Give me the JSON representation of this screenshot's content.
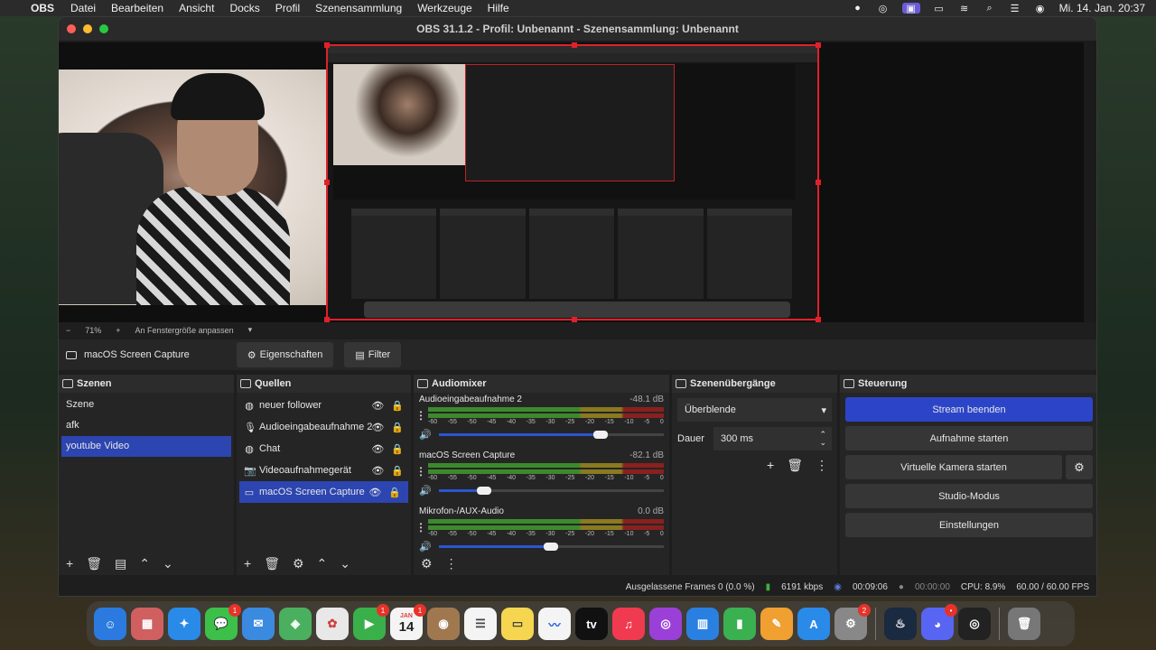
{
  "menubar": {
    "app_name": "OBS",
    "items": [
      "Datei",
      "Bearbeiten",
      "Ansicht",
      "Docks",
      "Profil",
      "Szenensammlung",
      "Werkzeuge",
      "Hilfe"
    ],
    "clock": "Mi. 14. Jan.  20:37"
  },
  "window": {
    "title": "OBS 31.1.2 - Profil: Unbenannt - Szenensammlung: Unbenannt"
  },
  "zoom": {
    "minus": "−",
    "level": "71%",
    "plus": "+",
    "fit_label": "An Fenstergröße anpassen"
  },
  "source_toolbar": {
    "selected_source": "macOS Screen Capture",
    "properties_label": "Eigenschaften",
    "filter_label": "Filter"
  },
  "scenes": {
    "title": "Szenen",
    "items": [
      {
        "label": "Szene"
      },
      {
        "label": "afk"
      },
      {
        "label": "youtube Video"
      }
    ],
    "selected_index": 2
  },
  "sources": {
    "title": "Quellen",
    "items": [
      {
        "label": "neuer follower",
        "icon": "globe-icon"
      },
      {
        "label": "Audioeingabeaufnahme 2",
        "icon": "microphone-icon"
      },
      {
        "label": "Chat",
        "icon": "globe-icon"
      },
      {
        "label": "Videoaufnahmegerät",
        "icon": "camera-icon"
      },
      {
        "label": "macOS Screen Capture",
        "icon": "monitor-icon"
      }
    ],
    "selected_index": 4
  },
  "mixer": {
    "title": "Audiomixer",
    "ticks": [
      "-60",
      "-55",
      "-50",
      "-45",
      "-40",
      "-35",
      "-30",
      "-25",
      "-20",
      "-15",
      "-10",
      "-5",
      "0"
    ],
    "channels": [
      {
        "name": "Audioeingabeaufnahme 2",
        "db": "-48.1 dB",
        "volume": 0.72
      },
      {
        "name": "macOS Screen Capture",
        "db": "-82.1 dB",
        "volume": 0.2
      },
      {
        "name": "Mikrofon-/AUX-Audio",
        "db": "0.0 dB",
        "volume": 0.5
      }
    ]
  },
  "transitions": {
    "title": "Szenenübergänge",
    "selected": "Überblende",
    "duration_label": "Dauer",
    "duration_value": "300 ms"
  },
  "controls": {
    "title": "Steuerung",
    "stream": "Stream beenden",
    "record": "Aufnahme starten",
    "virtual_cam": "Virtuelle Kamera starten",
    "studio": "Studio-Modus",
    "settings": "Einstellungen"
  },
  "status": {
    "dropped": "Ausgelassene Frames 0 (0.0 %)",
    "bitrate": "6191 kbps",
    "stream_time": "00:09:06",
    "rec_time": "00:00:00",
    "cpu": "CPU: 8.9%",
    "fps": "60.00 / 60.00 FPS"
  },
  "dock": {
    "calendar_month": "JAN",
    "calendar_day": "14",
    "appletv_label": "tv",
    "badges": {
      "messages": "1",
      "facetime": "1",
      "calendar": "1",
      "settings": "2",
      "discord": "•"
    }
  },
  "colors": {
    "accent": "#2c45c8",
    "selection": "#2c45b0",
    "capture_border": "#e0202a"
  }
}
